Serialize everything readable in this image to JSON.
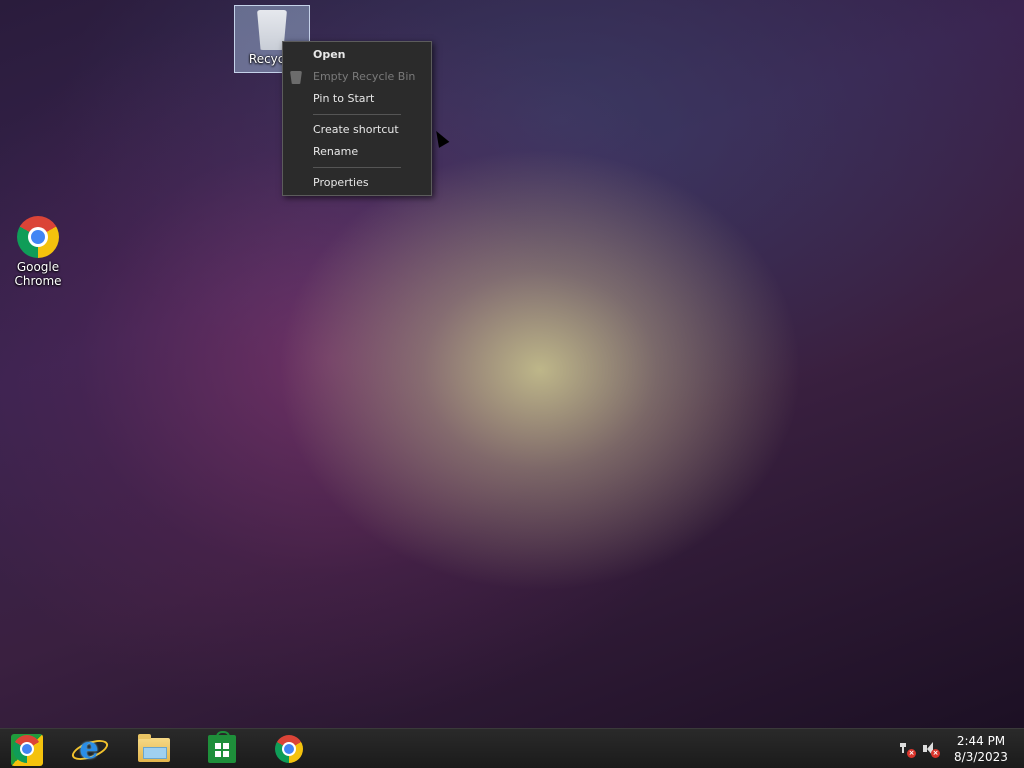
{
  "desktop": {
    "icons": [
      {
        "label": "Recycle Bin",
        "icon": "recycle-bin-icon",
        "selected": true
      },
      {
        "label": "Google Chrome",
        "label_line1": "Google",
        "label_line2": "Chrome",
        "icon": "chrome-icon"
      }
    ],
    "recycle_bin_label_visible": "Recycle"
  },
  "context_menu": {
    "items": [
      {
        "label": "Open",
        "bold": true,
        "enabled": true
      },
      {
        "label": "Empty Recycle Bin",
        "enabled": false,
        "icon": "recycle-bin-small-icon"
      },
      {
        "label": "Pin to Start",
        "enabled": true
      },
      {
        "separator": true
      },
      {
        "label": "Create shortcut",
        "enabled": true
      },
      {
        "label": "Rename",
        "enabled": true
      },
      {
        "separator": true
      },
      {
        "label": "Properties",
        "enabled": true
      }
    ]
  },
  "taskbar": {
    "pinned": [
      {
        "name": "Chrome (start)",
        "icon": "chrome-start-icon"
      },
      {
        "name": "Internet Explorer",
        "icon": "internet-explorer-icon"
      },
      {
        "name": "File Explorer",
        "icon": "file-explorer-icon"
      },
      {
        "name": "Store",
        "icon": "store-icon"
      },
      {
        "name": "Google Chrome",
        "icon": "chrome-icon"
      }
    ],
    "tray": {
      "network_status": "disconnected",
      "volume_status": "muted",
      "time": "2:44 PM",
      "date": "8/3/2023"
    }
  },
  "colors": {
    "menu_bg": "#2b2b2b",
    "menu_text": "#e8e8e8",
    "menu_disabled": "#7a7a7a",
    "taskbar_bg": "#1b1b1b",
    "selection": "#aac8e6"
  }
}
